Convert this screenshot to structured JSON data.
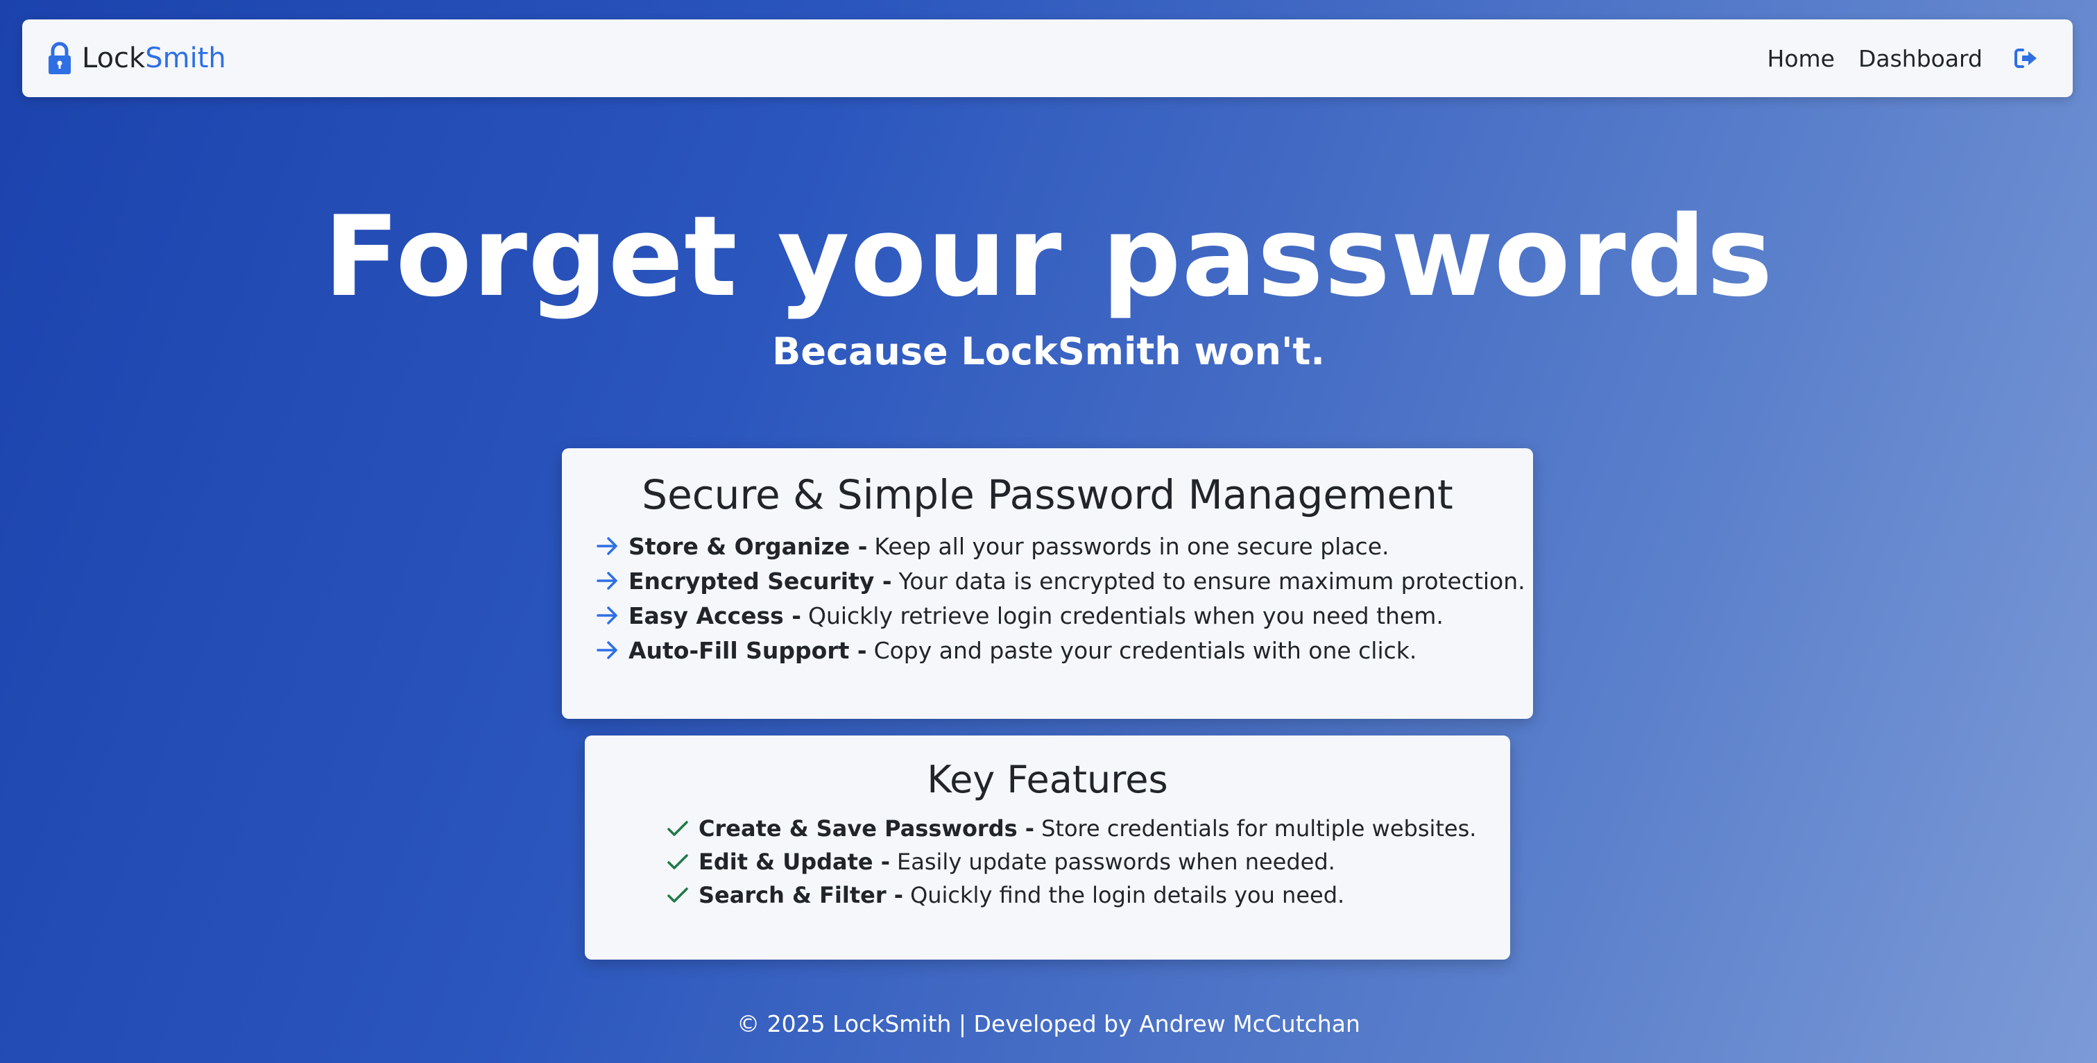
{
  "navbar": {
    "brand_lock": "Lock",
    "brand_smith": "Smith",
    "links": [
      {
        "label": "Home"
      },
      {
        "label": "Dashboard"
      }
    ],
    "logout_icon": "sign-out-icon"
  },
  "hero": {
    "title": "Forget your passwords",
    "subtitle": "Because LockSmith won't."
  },
  "management_card": {
    "title": "Secure & Simple Password Management",
    "items": [
      {
        "bold": "Store & Organize -",
        "text": "Keep all your passwords in one secure place."
      },
      {
        "bold": "Encrypted Security -",
        "text": "Your data is encrypted to ensure maximum protection."
      },
      {
        "bold": "Easy Access -",
        "text": "Quickly retrieve login credentials when you need them."
      },
      {
        "bold": "Auto-Fill Support -",
        "text": "Copy and paste your credentials with one click."
      }
    ]
  },
  "features_card": {
    "title": "Key Features",
    "items": [
      {
        "bold": "Create & Save Passwords -",
        "text": "Store credentials for multiple websites."
      },
      {
        "bold": "Edit & Update -",
        "text": "Easily update passwords when needed."
      },
      {
        "bold": "Search & Filter -",
        "text": "Quickly find the login details you need."
      }
    ]
  },
  "footer": {
    "text": "© 2025 LockSmith | Developed by Andrew McCutchan"
  },
  "colors": {
    "accent": "#2f6fe4",
    "check": "#1f7a47",
    "card_bg": "#f5f7fa"
  }
}
